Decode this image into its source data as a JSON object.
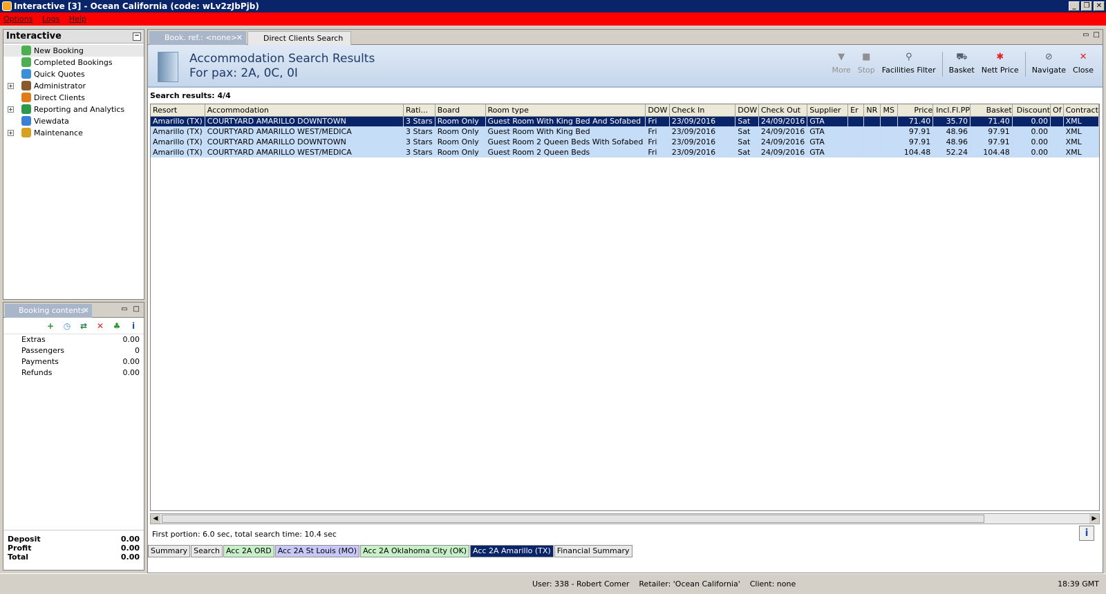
{
  "window": {
    "title": "Interactive [3] - Ocean California (code: wLv2zJbPjb)",
    "controls": [
      "_",
      "❐",
      "✕"
    ]
  },
  "menu": [
    "Options",
    "Logs",
    "Help"
  ],
  "nav": {
    "title": "Interactive",
    "items": [
      {
        "label": "New Booking",
        "icon": "palm-tree-icon",
        "color": "#4caf50",
        "expand": false
      },
      {
        "label": "Completed Bookings",
        "icon": "palm-tree-icon",
        "color": "#4caf50",
        "expand": false
      },
      {
        "label": "Quick Quotes",
        "icon": "clock-icon",
        "color": "#3a8fd8",
        "expand": false
      },
      {
        "label": "Administrator",
        "icon": "admin-icon",
        "color": "#8a5a2a",
        "expand": true
      },
      {
        "label": "Direct Clients",
        "icon": "clients-icon",
        "color": "#e07b1a",
        "expand": false
      },
      {
        "label": "Reporting and Analytics",
        "icon": "report-icon",
        "color": "#2a9a4a",
        "expand": true
      },
      {
        "label": "Viewdata",
        "icon": "globe-icon",
        "color": "#3a7fd8",
        "expand": false
      },
      {
        "label": "Maintenance",
        "icon": "tools-icon",
        "color": "#d8a020",
        "expand": true
      }
    ]
  },
  "booking_contents": {
    "tab_label": "Booking contents",
    "tools": [
      {
        "name": "add-icon",
        "glyph": "+",
        "color": "#2a9a2a"
      },
      {
        "name": "clock-icon",
        "glyph": "◷",
        "color": "#3a8fd8"
      },
      {
        "name": "transfer-icon",
        "glyph": "⇄",
        "color": "#2a7a4a"
      },
      {
        "name": "delete-icon",
        "glyph": "✕",
        "color": "#e02020"
      },
      {
        "name": "palm-tree-icon",
        "glyph": "♣",
        "color": "#2a9a2a"
      },
      {
        "name": "info-icon",
        "glyph": "i",
        "color": "#1b4fa0"
      }
    ],
    "rows": [
      {
        "label": "Extras",
        "value": "0.00"
      },
      {
        "label": "Passengers",
        "value": "0"
      },
      {
        "label": "Payments",
        "value": "0.00"
      },
      {
        "label": "Refunds",
        "value": "0.00"
      }
    ],
    "summary": [
      {
        "label": "Deposit",
        "value": "0.00"
      },
      {
        "label": "Profit",
        "value": "0.00"
      },
      {
        "label": "Total",
        "value": "0.00"
      }
    ]
  },
  "tabs": {
    "active": "Book. ref.: <none>",
    "inactive": "Direct Clients Search"
  },
  "header": {
    "title": "Accommodation Search Results",
    "subtitle": "For pax: 2A, 0C, 0I",
    "buttons": [
      {
        "label": "More",
        "icon": "more-icon",
        "glyph": "▼",
        "disabled": true
      },
      {
        "label": "Stop",
        "icon": "stop-icon",
        "glyph": "■",
        "disabled": true
      },
      {
        "label": "Facilities Filter",
        "icon": "filter-icon",
        "glyph": "⚲",
        "disabled": false,
        "sep_after": true
      },
      {
        "label": "Basket",
        "icon": "basket-icon",
        "glyph": "⛟",
        "disabled": false
      },
      {
        "label": "Nett Price",
        "icon": "nett-price-icon",
        "glyph": "✱",
        "disabled": false,
        "sep_after": true
      },
      {
        "label": "Navigate",
        "icon": "navigate-icon",
        "glyph": "⊘",
        "disabled": false
      },
      {
        "label": "Close",
        "icon": "close-icon",
        "glyph": "✕",
        "disabled": false
      }
    ]
  },
  "results": {
    "label": "Search results: 4/4",
    "columns": [
      "Resort",
      "Accommodation",
      "Rati...",
      "Board",
      "Room type",
      "DOW",
      "Check In",
      "DOW",
      "Check Out",
      "Supplier",
      "Er",
      "NR",
      "MS",
      "Price",
      "Incl.Fl.PP",
      "Basket",
      "Discount",
      "Of",
      "Contract"
    ],
    "rows": [
      [
        "Amarillo (TX)",
        "COURTYARD AMARILLO DOWNTOWN",
        "3 Stars",
        "Room Only",
        "Guest Room With King Bed And Sofabed",
        "Fri",
        "23/09/2016",
        "Sat",
        "24/09/2016",
        "GTA",
        "",
        "",
        "",
        "71.40",
        "35.70",
        "71.40",
        "0.00",
        "",
        "XML"
      ],
      [
        "Amarillo (TX)",
        "COURTYARD AMARILLO WEST/MEDICA",
        "3 Stars",
        "Room Only",
        "Guest Room With King Bed",
        "Fri",
        "23/09/2016",
        "Sat",
        "24/09/2016",
        "GTA",
        "",
        "",
        "",
        "97.91",
        "48.96",
        "97.91",
        "0.00",
        "",
        "XML"
      ],
      [
        "Amarillo (TX)",
        "COURTYARD AMARILLO DOWNTOWN",
        "3 Stars",
        "Room Only",
        "Guest Room 2 Queen Beds With Sofabed",
        "Fri",
        "23/09/2016",
        "Sat",
        "24/09/2016",
        "GTA",
        "",
        "",
        "",
        "97.91",
        "48.96",
        "97.91",
        "0.00",
        "",
        "XML"
      ],
      [
        "Amarillo (TX)",
        "COURTYARD AMARILLO WEST/MEDICA",
        "3 Stars",
        "Room Only",
        "Guest Room 2 Queen Beds",
        "Fri",
        "23/09/2016",
        "Sat",
        "24/09/2016",
        "GTA",
        "",
        "",
        "",
        "104.48",
        "52.24",
        "104.48",
        "0.00",
        "",
        "XML"
      ]
    ],
    "selected_row": 0
  },
  "timing": "First portion: 6.0 sec, total search time: 10.4 sec",
  "bottom_tabs": [
    {
      "label": "Summary",
      "style": "plain"
    },
    {
      "label": "Search",
      "style": "plain"
    },
    {
      "label": "Acc 2A ORD",
      "style": "green"
    },
    {
      "label": "Acc 2A St Louis (MO)",
      "style": "lav"
    },
    {
      "label": "Acc 2A Oklahoma City (OK)",
      "style": "green"
    },
    {
      "label": "Acc 2A Amarillo (TX)",
      "style": "dark"
    },
    {
      "label": "Financial Summary",
      "style": "plain"
    }
  ],
  "status": {
    "user": "User: 338 - Robert Comer    Retailer: 'Ocean California'    Client: none",
    "time": "18:39 GMT"
  }
}
